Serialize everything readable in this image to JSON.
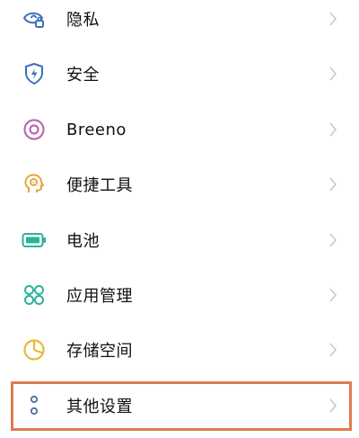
{
  "settings": {
    "items": [
      {
        "label": "隐私",
        "icon": "privacy-eye-lock-icon"
      },
      {
        "label": "安全",
        "icon": "security-shield-icon"
      },
      {
        "label": "Breeno",
        "icon": "breeno-ring-icon"
      },
      {
        "label": "便捷工具",
        "icon": "tools-head-icon"
      },
      {
        "label": "电池",
        "icon": "battery-icon"
      },
      {
        "label": "应用管理",
        "icon": "app-grid-icon"
      },
      {
        "label": "存储空间",
        "icon": "storage-pie-icon"
      },
      {
        "label": "其他设置",
        "icon": "other-dots-icon"
      }
    ]
  },
  "colors": {
    "highlight_border": "#e07a4f",
    "privacy": "#3a6fbf",
    "security": "#3a6fbf",
    "breeno": "#b86bb3",
    "tools": "#e8a33a",
    "battery": "#2bb39a",
    "apps": "#2bb39a",
    "storage": "#e8b93a",
    "other": "#4a6fa8",
    "chevron": "#c8c8c8"
  }
}
